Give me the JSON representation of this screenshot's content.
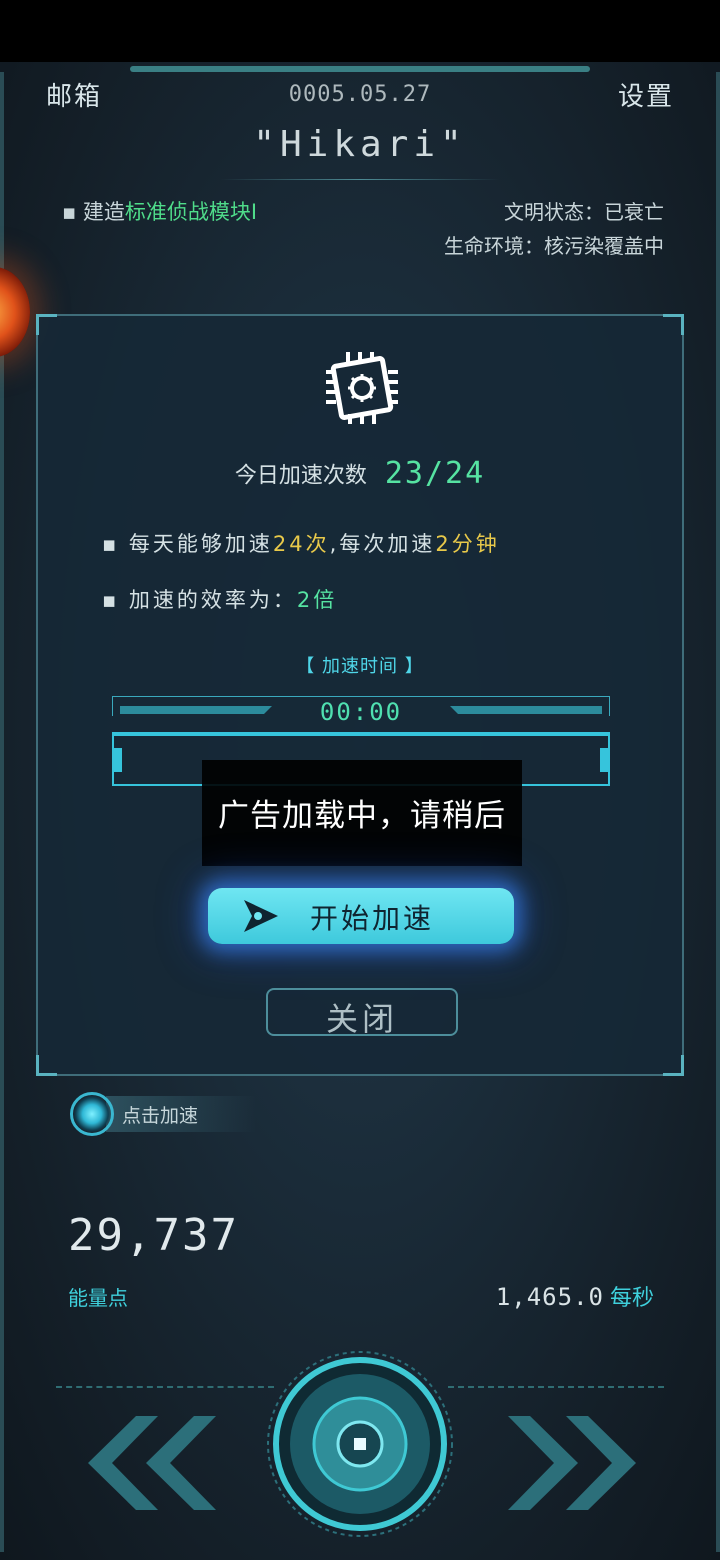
{
  "header": {
    "mail_label": "邮箱",
    "date": "0005.05.27",
    "settings_label": "设置",
    "planet_name": "\"Hikari\""
  },
  "status": {
    "build_prefix": "建造",
    "build_target": "标准侦战模块Ⅰ",
    "civilization": "文明状态：已衰亡",
    "environment": "生命环境：核污染覆盖中"
  },
  "modal": {
    "count_label": "今日加速次数",
    "count_value": "23/24",
    "rule1_a": "每天能够加速",
    "rule1_b": "24次",
    "rule1_c": ",每次加速",
    "rule1_d": "2分钟",
    "rule2_a": "加速的效率为：",
    "rule2_b": "2倍",
    "timer_label": "【 加速时间 】",
    "timer_value": "00:00",
    "ad_loading_text": "广告加载中，请稍后",
    "start_button": "开始加速",
    "close_button": "关闭"
  },
  "accelerate_tap": {
    "label": "点击加速"
  },
  "energy": {
    "value": "29,737",
    "label": "能量点",
    "rate_value": "1,465.0",
    "rate_unit": "每秒"
  },
  "colors": {
    "accent_cyan": "#3fd0dc",
    "accent_green": "#56e3a2",
    "accent_yellow": "#e8c94a"
  },
  "icons": {
    "chip": "chip-icon",
    "play": "play-icon",
    "prev": "double-chevron-left-icon",
    "next": "double-chevron-right-icon",
    "center": "target-button-icon"
  }
}
